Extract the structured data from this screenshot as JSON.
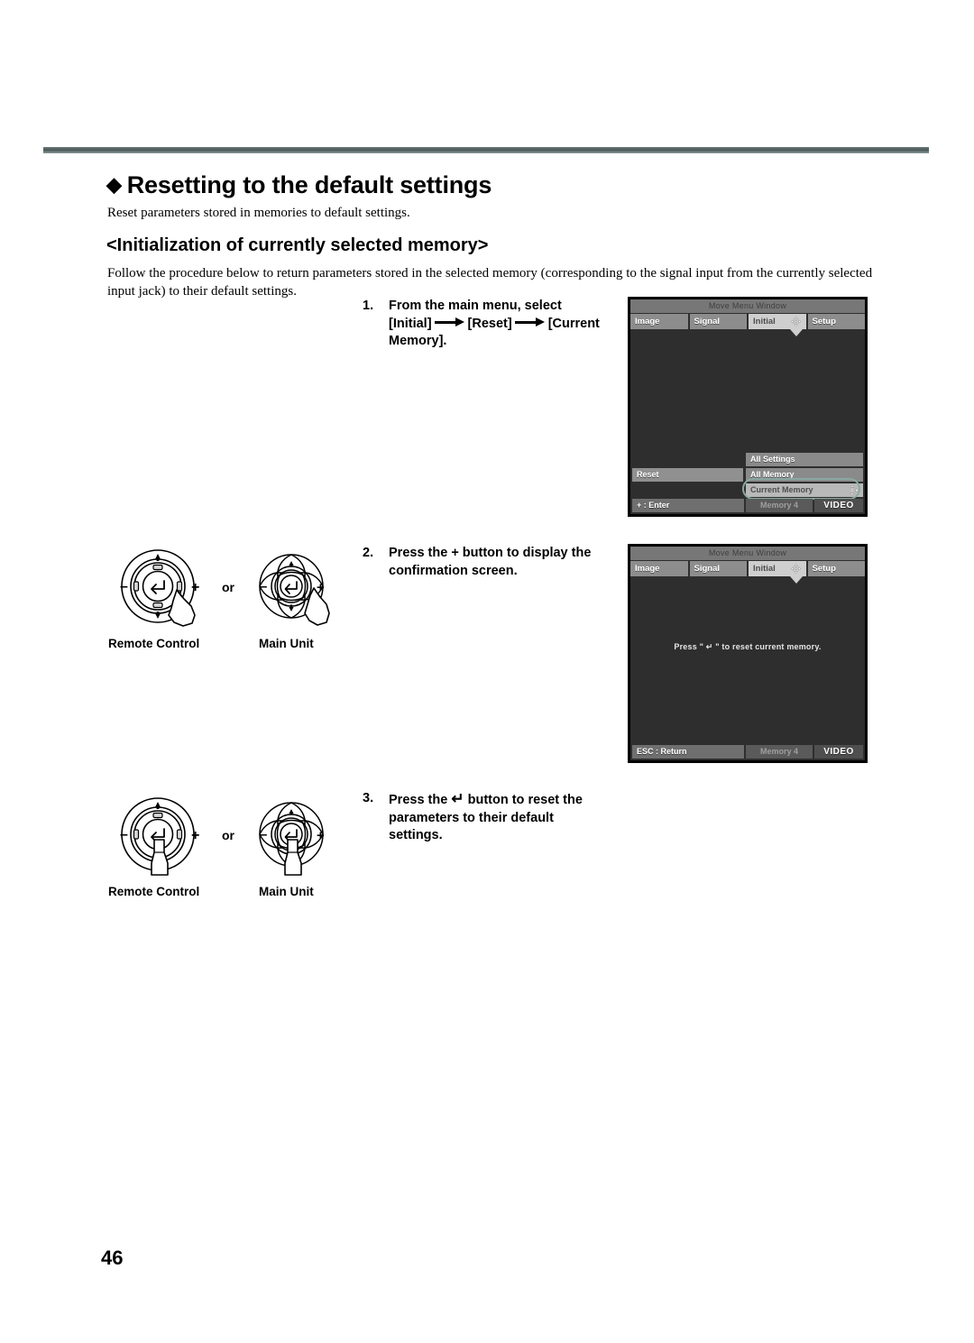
{
  "page": {
    "number": "46"
  },
  "headings": {
    "title": "Resetting to the default settings",
    "title_bullet": "◆",
    "lead": "Reset parameters stored in memories to default settings.",
    "subtitle": "<Initialization of currently selected memory>",
    "paragraph": "Follow the procedure below to return parameters stored in the selected memory (corresponding to the signal input from the currently selected input jack) to their default settings."
  },
  "steps": [
    {
      "number": "1.",
      "line1": "From the main menu, select",
      "menu1": "[Initial]",
      "menu2": "[Reset]",
      "menu3": "[Current",
      "line3": "Memory]."
    },
    {
      "number": "2.",
      "line1": "Press the + button to display the",
      "line2": "confirmation screen."
    },
    {
      "number": "3.",
      "pre": "Press the",
      "glyph": "↵",
      "post": "button to reset the",
      "line2": "parameters to their default",
      "line3": "settings."
    }
  ],
  "osd1": {
    "title": "Move Menu Window",
    "tabs": [
      {
        "label": "Image",
        "selected": false
      },
      {
        "label": "Signal",
        "selected": false
      },
      {
        "label": "Initial",
        "selected": true
      },
      {
        "label": "Setup",
        "selected": false
      }
    ],
    "submenu": {
      "left_label": "Reset",
      "items": [
        {
          "label": "All Settings",
          "highlighted": false
        },
        {
          "label": "All Memory",
          "highlighted": false
        },
        {
          "label": "Current Memory",
          "highlighted": true
        }
      ]
    },
    "status": {
      "left": "+ : Enter",
      "middle": "Memory 4",
      "right": "VIDEO"
    },
    "annotation_color": "#8aa9a2"
  },
  "osd2": {
    "title": "Move Menu Window",
    "tabs": [
      {
        "label": "Image",
        "selected": false
      },
      {
        "label": "Signal",
        "selected": false
      },
      {
        "label": "Initial",
        "selected": true
      },
      {
        "label": "Setup",
        "selected": false
      }
    ],
    "message": "Press \" ↵ \" to reset current memory.",
    "status": {
      "left": "ESC : Return",
      "middle": "Memory 4",
      "right": "VIDEO"
    }
  },
  "figures": [
    {
      "or": "or",
      "remote_label": "Remote Control",
      "main_label": "Main Unit",
      "buttons": {
        "minus": "–",
        "plus": "+",
        "up": "▲",
        "down": "▼",
        "enter": "↵"
      }
    },
    {
      "or": "or",
      "remote_label": "Remote Control",
      "main_label": "Main Unit",
      "buttons": {
        "minus": "–",
        "plus": "+",
        "up": "▲",
        "down": "▼",
        "enter": "↵"
      }
    }
  ]
}
